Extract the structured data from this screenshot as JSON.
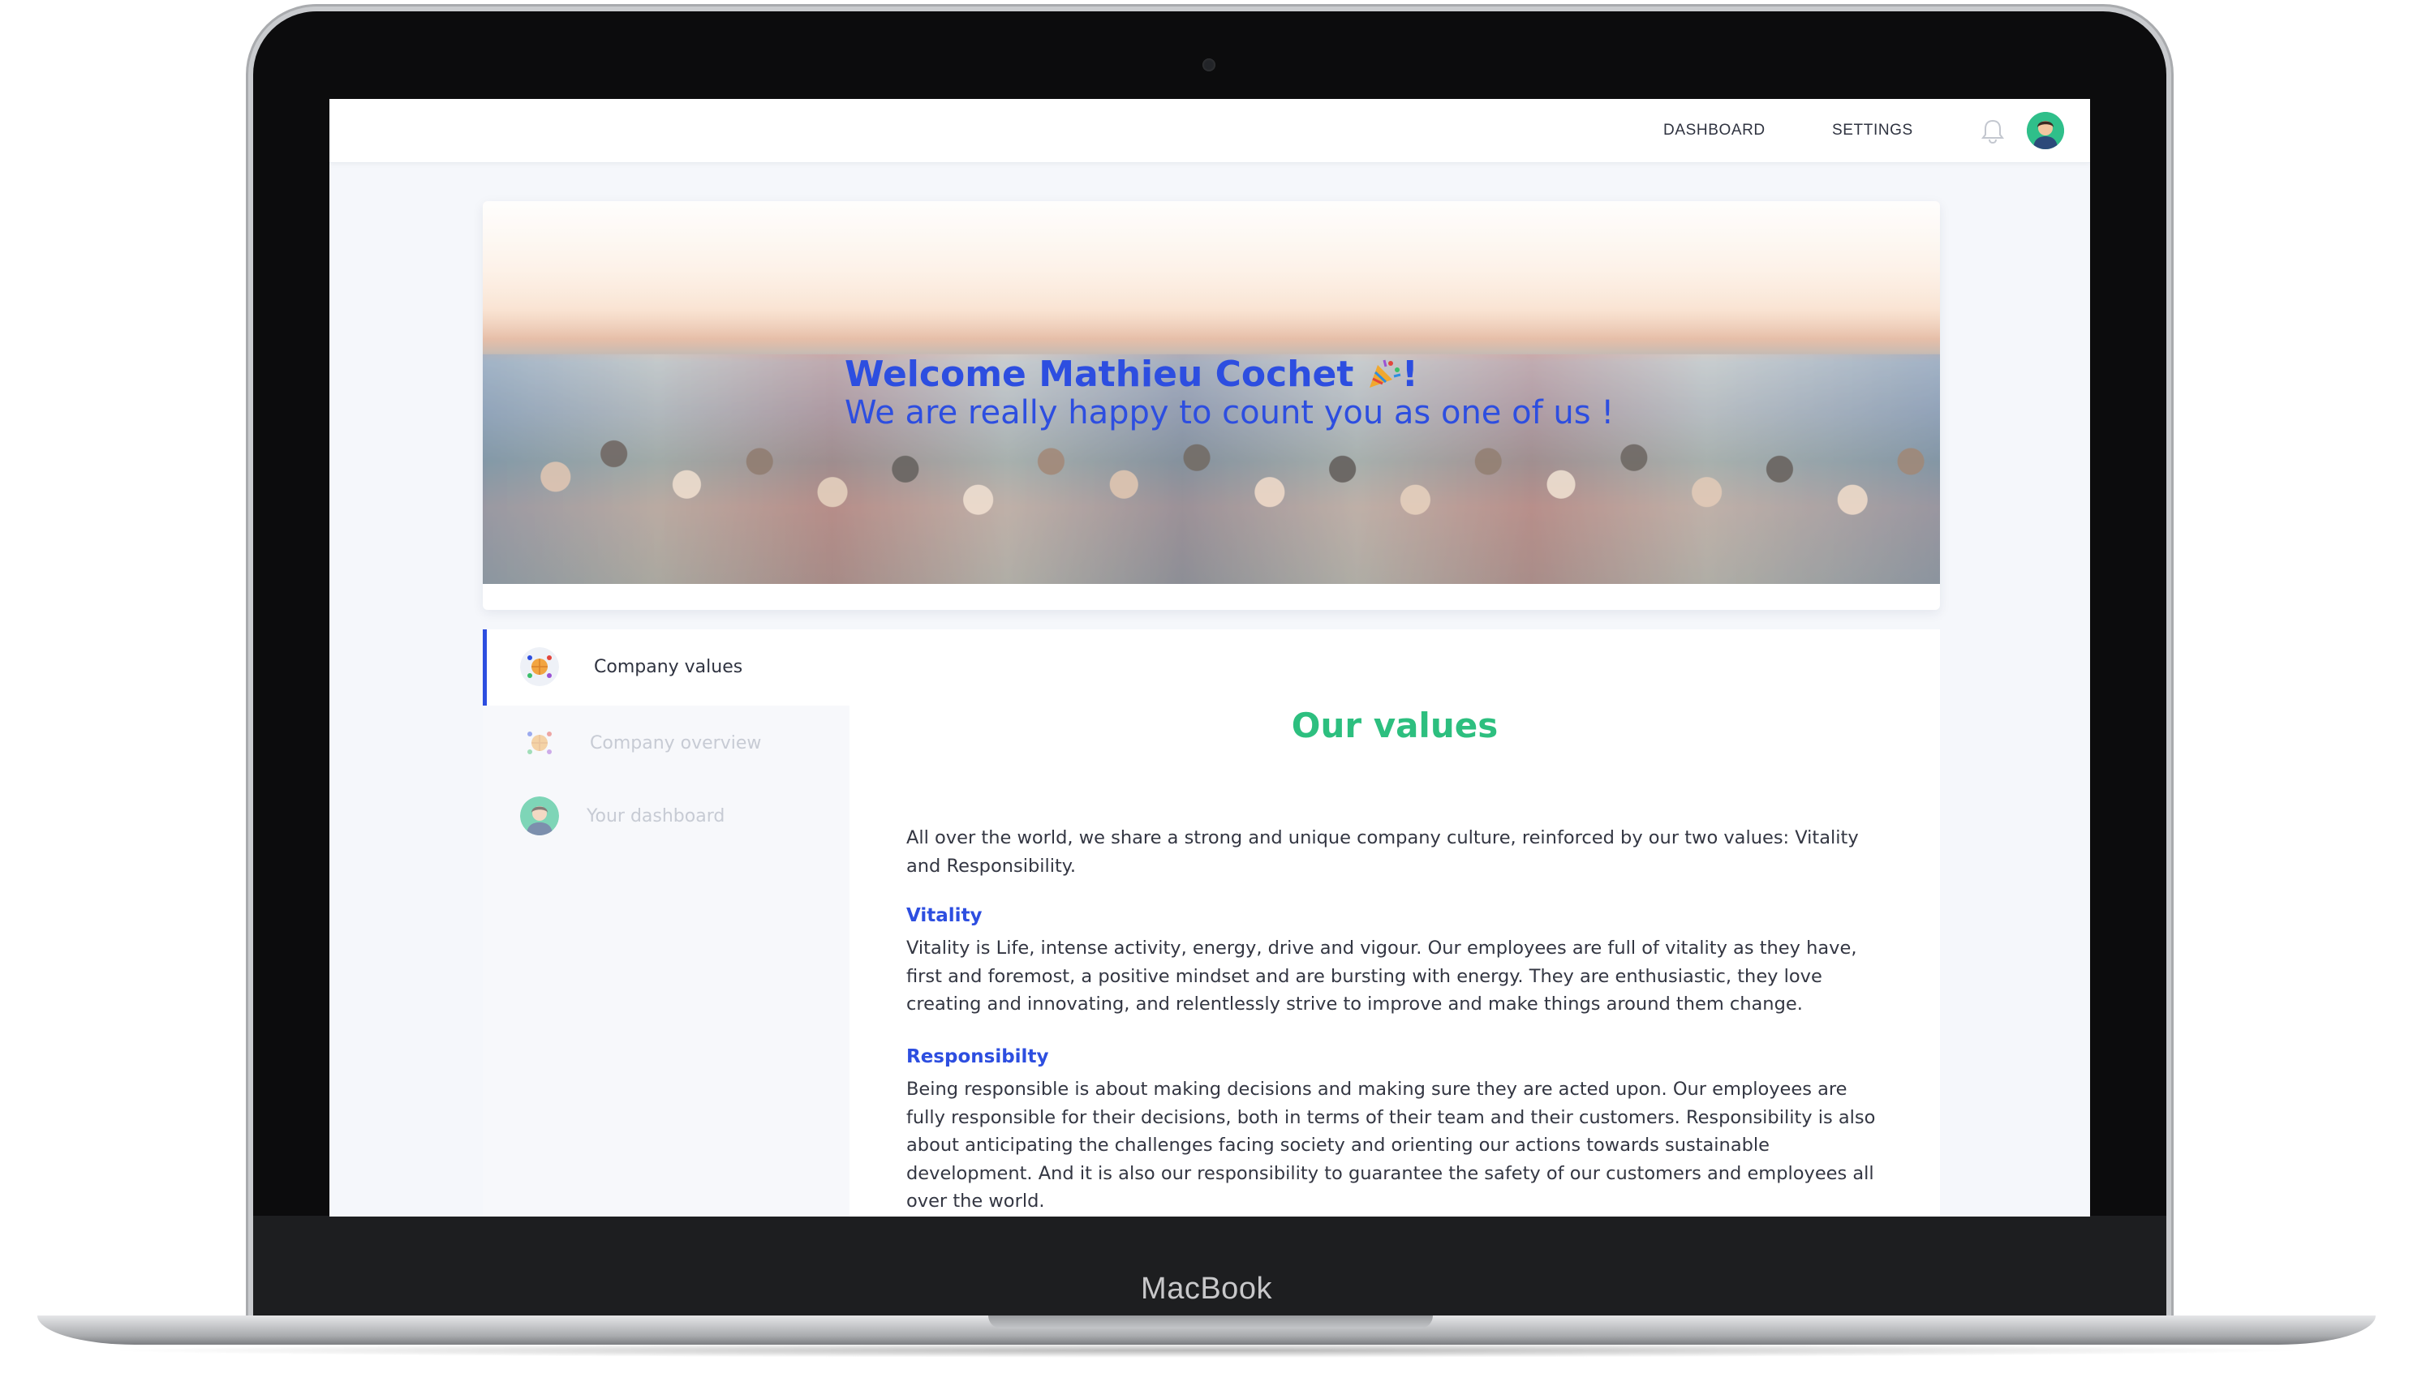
{
  "device": {
    "brand": "MacBook"
  },
  "topbar": {
    "nav": [
      {
        "label": "DASHBOARD"
      },
      {
        "label": "SETTINGS"
      }
    ],
    "icons": {
      "notifications": "bell-icon",
      "profile": "avatar"
    }
  },
  "banner": {
    "greeting": "Welcome Mathieu Cochet",
    "greeting_suffix": "!",
    "greeting_icon": "party-popper-icon",
    "subtitle": "We are really happy to count you as one of us !"
  },
  "sidebar": {
    "items": [
      {
        "label": "Company values",
        "icon": "globe-people-icon",
        "active": true
      },
      {
        "label": "Company overview",
        "icon": "globe-people-icon",
        "active": false
      },
      {
        "label": "Your dashboard",
        "icon": "avatar-icon",
        "active": false
      }
    ]
  },
  "content": {
    "title": "Our values",
    "intro": "All over the world, we share a strong and unique company culture, reinforced by our two values: Vitality and Responsibility.",
    "sections": [
      {
        "heading": "Vitality",
        "body": "Vitality is Life, intense activity, energy, drive and vigour. Our employees are full of vitality as they have, first and foremost, a positive mindset and are bursting with energy. They are enthusiastic, they love creating and innovating, and relentlessly strive to improve and make things around them change."
      },
      {
        "heading": "Responsibilty",
        "body": "Being responsible is about making decisions and making sure they are acted upon. Our employees are fully responsible for their decisions, both in terms of their team and their customers. Responsibility is also about anticipating the challenges facing society and orienting our actions towards sustainable development. And it is also our responsibility to guarantee the safety of our customers and employees all over the world."
      }
    ]
  },
  "colors": {
    "accent_blue": "#2d4ee0",
    "accent_green": "#2dbf7f",
    "inactive_text": "#c7cbd4",
    "text": "#333642"
  }
}
